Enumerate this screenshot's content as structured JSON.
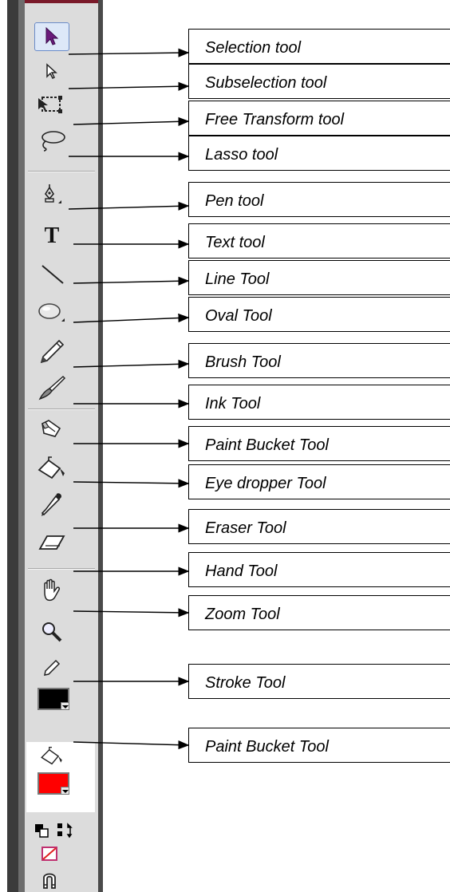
{
  "tools": [
    {
      "id": "selection",
      "icon": "selection-arrow-icon",
      "label": "Selection tool",
      "selected": true
    },
    {
      "id": "subselection",
      "icon": "subselection-arrow-icon",
      "label": "Subselection tool"
    },
    {
      "id": "free-transform",
      "icon": "free-transform-icon",
      "label": "Free Transform tool"
    },
    {
      "id": "lasso",
      "icon": "lasso-icon",
      "label": "Lasso tool"
    },
    {
      "id": "pen",
      "icon": "pen-nib-icon",
      "label": "Pen tool"
    },
    {
      "id": "text",
      "icon": "text-icon",
      "label": "Text tool",
      "glyph": "T"
    },
    {
      "id": "line",
      "icon": "line-icon",
      "label": "Line Tool"
    },
    {
      "id": "oval",
      "icon": "oval-icon",
      "label": "Oval Tool"
    },
    {
      "id": "pencil",
      "icon": "pencil-icon",
      "label": "Brush Tool"
    },
    {
      "id": "brush",
      "icon": "brush-icon",
      "label": "Ink Tool"
    },
    {
      "id": "ink-bottle",
      "icon": "ink-bottle-icon",
      "label": "Paint Bucket Tool"
    },
    {
      "id": "paint-bucket",
      "icon": "paint-bucket-icon",
      "label": "Eye dropper Tool"
    },
    {
      "id": "eyedropper",
      "icon": "eyedropper-icon",
      "label": "Eraser Tool"
    },
    {
      "id": "eraser",
      "icon": "eraser-icon",
      "label": ""
    },
    {
      "id": "hand",
      "icon": "hand-icon",
      "label": ""
    },
    {
      "id": "zoom",
      "icon": "magnifier-icon",
      "label": ""
    }
  ],
  "separator_labels": {
    "hand": "Hand Tool",
    "zoom": "Zoom Tool"
  },
  "colors": {
    "stroke_label": "Stroke Tool",
    "fill_label": "Paint Bucket Tool",
    "stroke_color": "#000000",
    "fill_color": "#ff0000",
    "stroke_icon": "pencil-icon",
    "fill_icon": "paint-bucket-icon"
  },
  "bottom_icons": [
    "black-white-icon",
    "swap-colors-icon",
    "no-color-icon",
    "snap-magnet-icon"
  ]
}
